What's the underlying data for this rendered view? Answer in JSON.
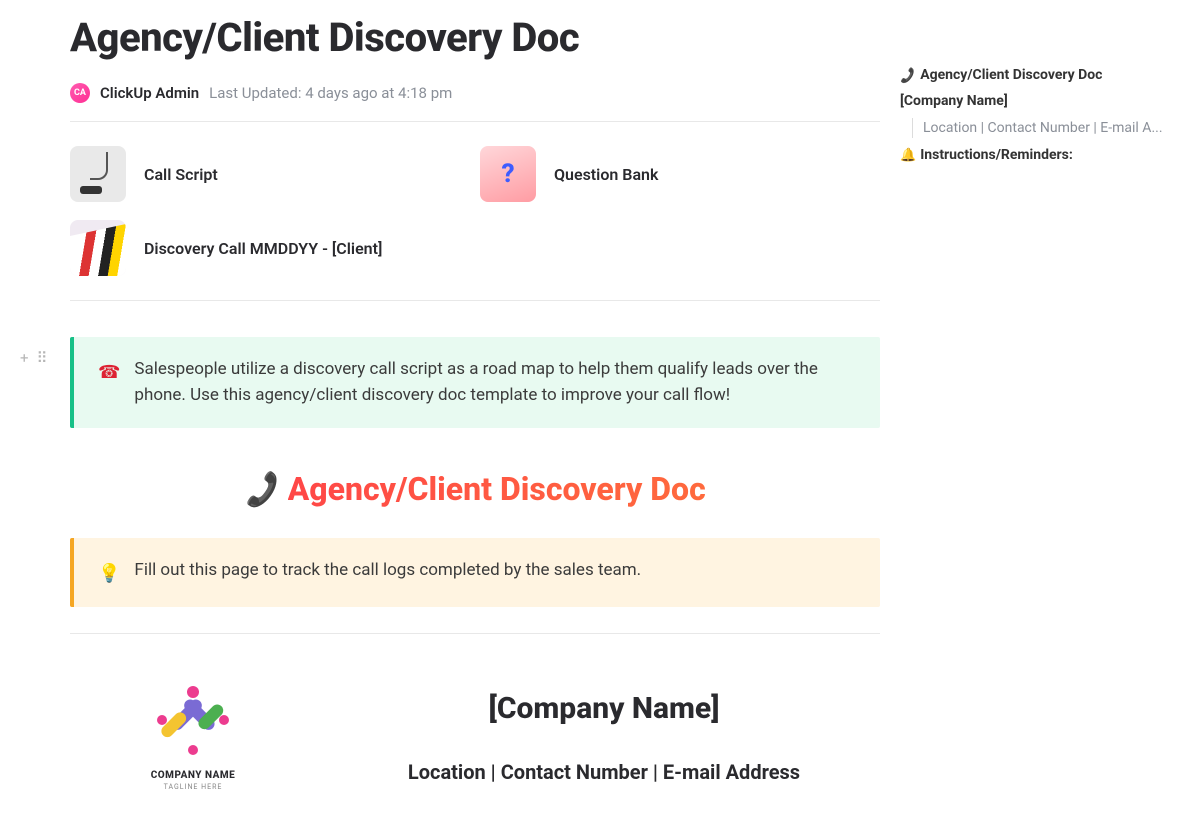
{
  "header": {
    "title": "Agency/Client Discovery Doc",
    "avatar_initials": "CA",
    "author": "ClickUp Admin",
    "last_updated_label": "Last Updated:",
    "last_updated_value": " 4 days ago at 4:18 pm"
  },
  "cards": [
    {
      "label": "Call Script",
      "thumb": "grey"
    },
    {
      "label": "Question Bank",
      "thumb": "pink",
      "glyph": "?"
    },
    {
      "label": "Discovery Call MMDDYY - [Client]",
      "thumb": "stack"
    }
  ],
  "callout_green": {
    "icon": "☎",
    "text": "Salespeople utilize a discovery call script as a road map to help them qualify leads over the phone. Use this agency/client discovery doc template to improve your call flow!"
  },
  "heading_red": {
    "icon": "📞",
    "text": "Agency/Client Discovery Doc"
  },
  "callout_yellow": {
    "icon": "💡",
    "text": "Fill out this page to track the call logs completed by the sales team."
  },
  "company": {
    "logo_name": "COMPANY NAME",
    "logo_tag": "TAGLINE HERE",
    "name": "[Company Name]",
    "sub": "Location | Contact Number | E-mail Address"
  },
  "toc": {
    "item1": "Agency/Client Discovery Doc",
    "item2": "[Company Name]",
    "item2_sub": "Location | Contact Number | E-mail A...",
    "item3_icon": "🔔",
    "item3": "Instructions/Reminders:"
  },
  "gutter": {
    "add": "+",
    "drag": "⠿"
  }
}
